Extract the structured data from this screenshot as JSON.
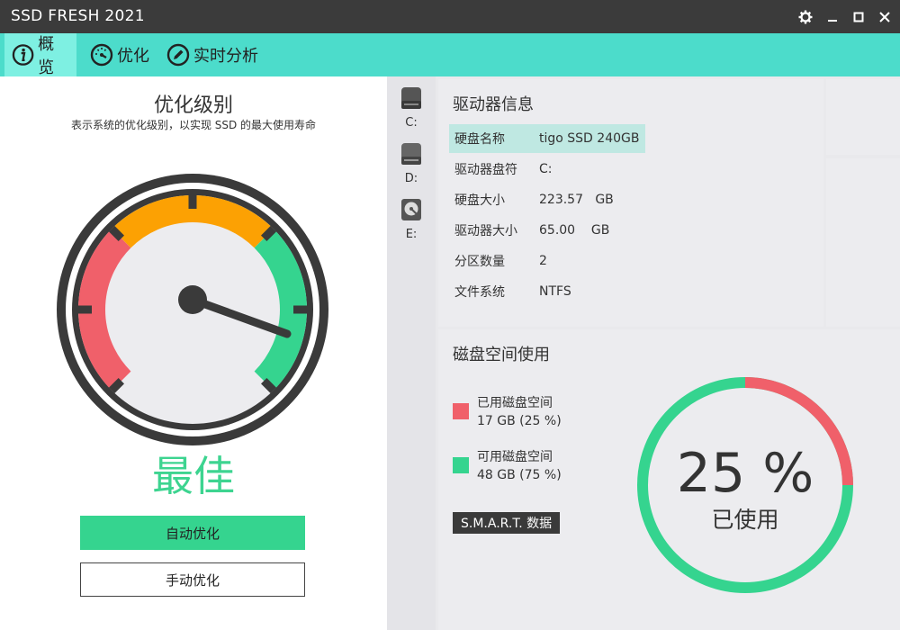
{
  "window": {
    "title": "SSD FRESH 2021"
  },
  "nav": {
    "tabs": [
      {
        "label": "概览",
        "icon": "info-icon",
        "active": true
      },
      {
        "label": "优化",
        "icon": "speedometer-icon",
        "active": false
      },
      {
        "label": "实时分析",
        "icon": "pencil-icon",
        "active": false
      }
    ]
  },
  "optimization": {
    "title": "优化级别",
    "description": "表示系统的优化级别，以实现 SSD 的最大使用寿命",
    "level": "最佳",
    "auto_button": "自动优化",
    "manual_button": "手动优化"
  },
  "drives": [
    {
      "letter": "C:",
      "icon": "hard-drive-icon",
      "selected": true
    },
    {
      "letter": "D:",
      "icon": "hard-drive-icon",
      "selected": false
    },
    {
      "letter": "E:",
      "icon": "disk-platter-icon",
      "selected": false
    }
  ],
  "drive_info": {
    "title": "驱动器信息",
    "rows": [
      {
        "key": "硬盘名称",
        "value": "tigo SSD 240GB"
      },
      {
        "key": "驱动器盘符",
        "value": "C:"
      },
      {
        "key": "硬盘大小",
        "value": "223.57   GB"
      },
      {
        "key": "驱动器大小",
        "value": "65.00    GB"
      },
      {
        "key": "分区数量",
        "value": "2"
      },
      {
        "key": "文件系统",
        "value": "NTFS"
      }
    ]
  },
  "disk_usage": {
    "title": "磁盘空间使用",
    "used_label": "已用磁盘空间",
    "used_value": "17 GB (25 %)",
    "free_label": "可用磁盘空间",
    "free_value": "48 GB (75 %)",
    "smart_button": "S.M.A.R.T. 数据",
    "percent_text": "25 %",
    "percent_caption": "已使用",
    "used_fraction": 0.25
  },
  "colors": {
    "accent": "#4cdccb",
    "accent_light": "#7ef0e2",
    "used": "#f0606a",
    "free": "#35d48f",
    "orange": "#fca103",
    "dark": "#3b3b3b"
  }
}
